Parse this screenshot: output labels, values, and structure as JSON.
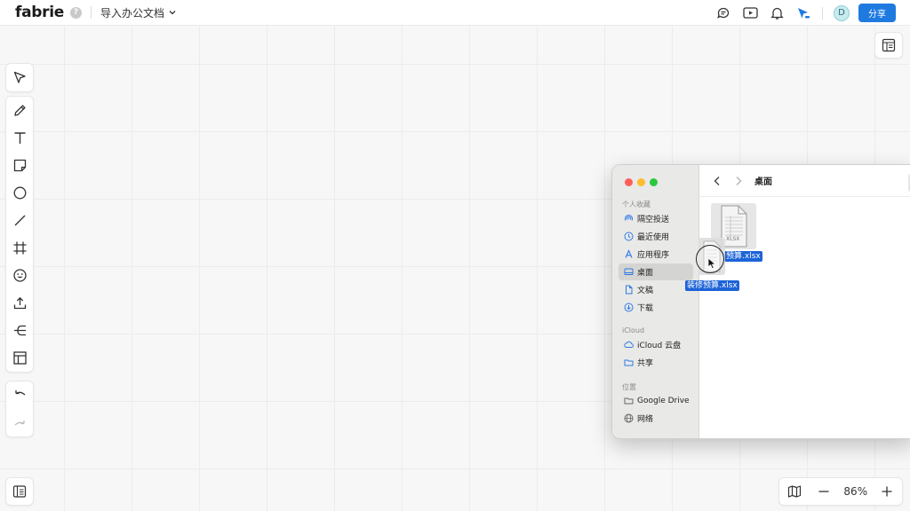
{
  "header": {
    "logo": "fabrie",
    "help_badge": "?",
    "doc_title": "导入办公文档",
    "avatar_initial": "D",
    "share_label": "分享"
  },
  "toolbar": {
    "tools": [
      "select-icon",
      "pen-icon",
      "text-icon",
      "sticky-note-icon",
      "circle-icon",
      "line-icon",
      "frame-icon",
      "emoji-icon",
      "upload-icon",
      "mindmap-icon",
      "template-icon"
    ],
    "history": [
      "undo-icon",
      "redo-icon"
    ]
  },
  "zoom": {
    "level": "86%"
  },
  "finder": {
    "location": "桌面",
    "sections": [
      {
        "title": "个人收藏",
        "items": [
          "隔空投送",
          "最近使用",
          "应用程序",
          "桌面",
          "文稿",
          "下载"
        ]
      },
      {
        "title": "iCloud",
        "items": [
          "iCloud 云盘",
          "共享"
        ]
      },
      {
        "title": "位置",
        "items": [
          "Google Drive",
          "网络"
        ]
      }
    ],
    "selected_item": "桌面",
    "file_label": "预算.xlsx",
    "file_icon_text": "XLSX",
    "drag_label": "装修预算.xlsx"
  },
  "colors": {
    "accent": "#1f7ae0",
    "selection": "#1d63d8",
    "traffic_red": "#fe5f57",
    "traffic_yellow": "#febc2e",
    "traffic_green": "#28c840"
  }
}
